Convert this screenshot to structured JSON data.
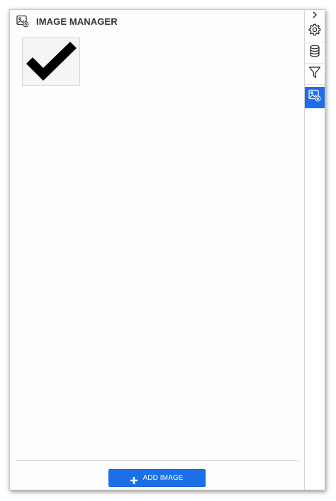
{
  "panel": {
    "title": "IMAGE MANAGER",
    "header_icon": "image-settings-icon"
  },
  "images": [
    {
      "name": "checkmark",
      "icon": "checkmark-icon"
    }
  ],
  "footer": {
    "add_button_label": "ADD IMAGE",
    "add_button_icon": "plus-icon"
  },
  "side_rail": {
    "collapse_icon": "chevron-right-icon",
    "items": [
      {
        "name": "settings",
        "icon": "gear-icon",
        "active": false
      },
      {
        "name": "data-source",
        "icon": "database-icon",
        "active": false
      },
      {
        "name": "filter",
        "icon": "filter-icon",
        "active": false
      },
      {
        "name": "image-manager",
        "icon": "image-settings-icon",
        "active": true
      }
    ]
  },
  "colors": {
    "accent": "#1b6fe8",
    "title_text": "#333333",
    "border": "#c9c9c9"
  }
}
